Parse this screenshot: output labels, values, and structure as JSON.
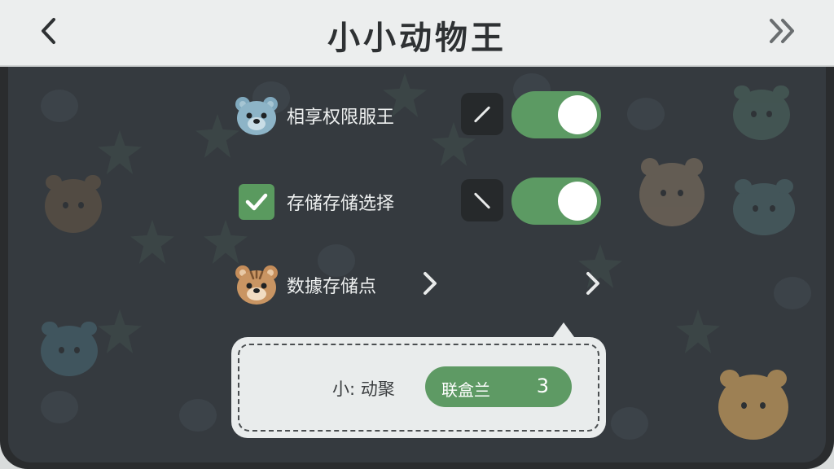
{
  "header": {
    "title": "小小动物王"
  },
  "settings": {
    "row1": {
      "label": "相享权限服王",
      "icon": "blue-bear-icon",
      "enabled": true
    },
    "row2": {
      "label": "存储存储选择",
      "icon": "checkbox-icon",
      "checked": true,
      "enabled": true
    },
    "row3": {
      "label": "数據存储点",
      "icon": "tiger-icon"
    }
  },
  "popup": {
    "label": "小: 动聚",
    "pill_text": "联盒兰",
    "count": "3"
  },
  "colors": {
    "accent": "#5c9a63",
    "background": "#353a3f",
    "header": "#eceeee"
  }
}
